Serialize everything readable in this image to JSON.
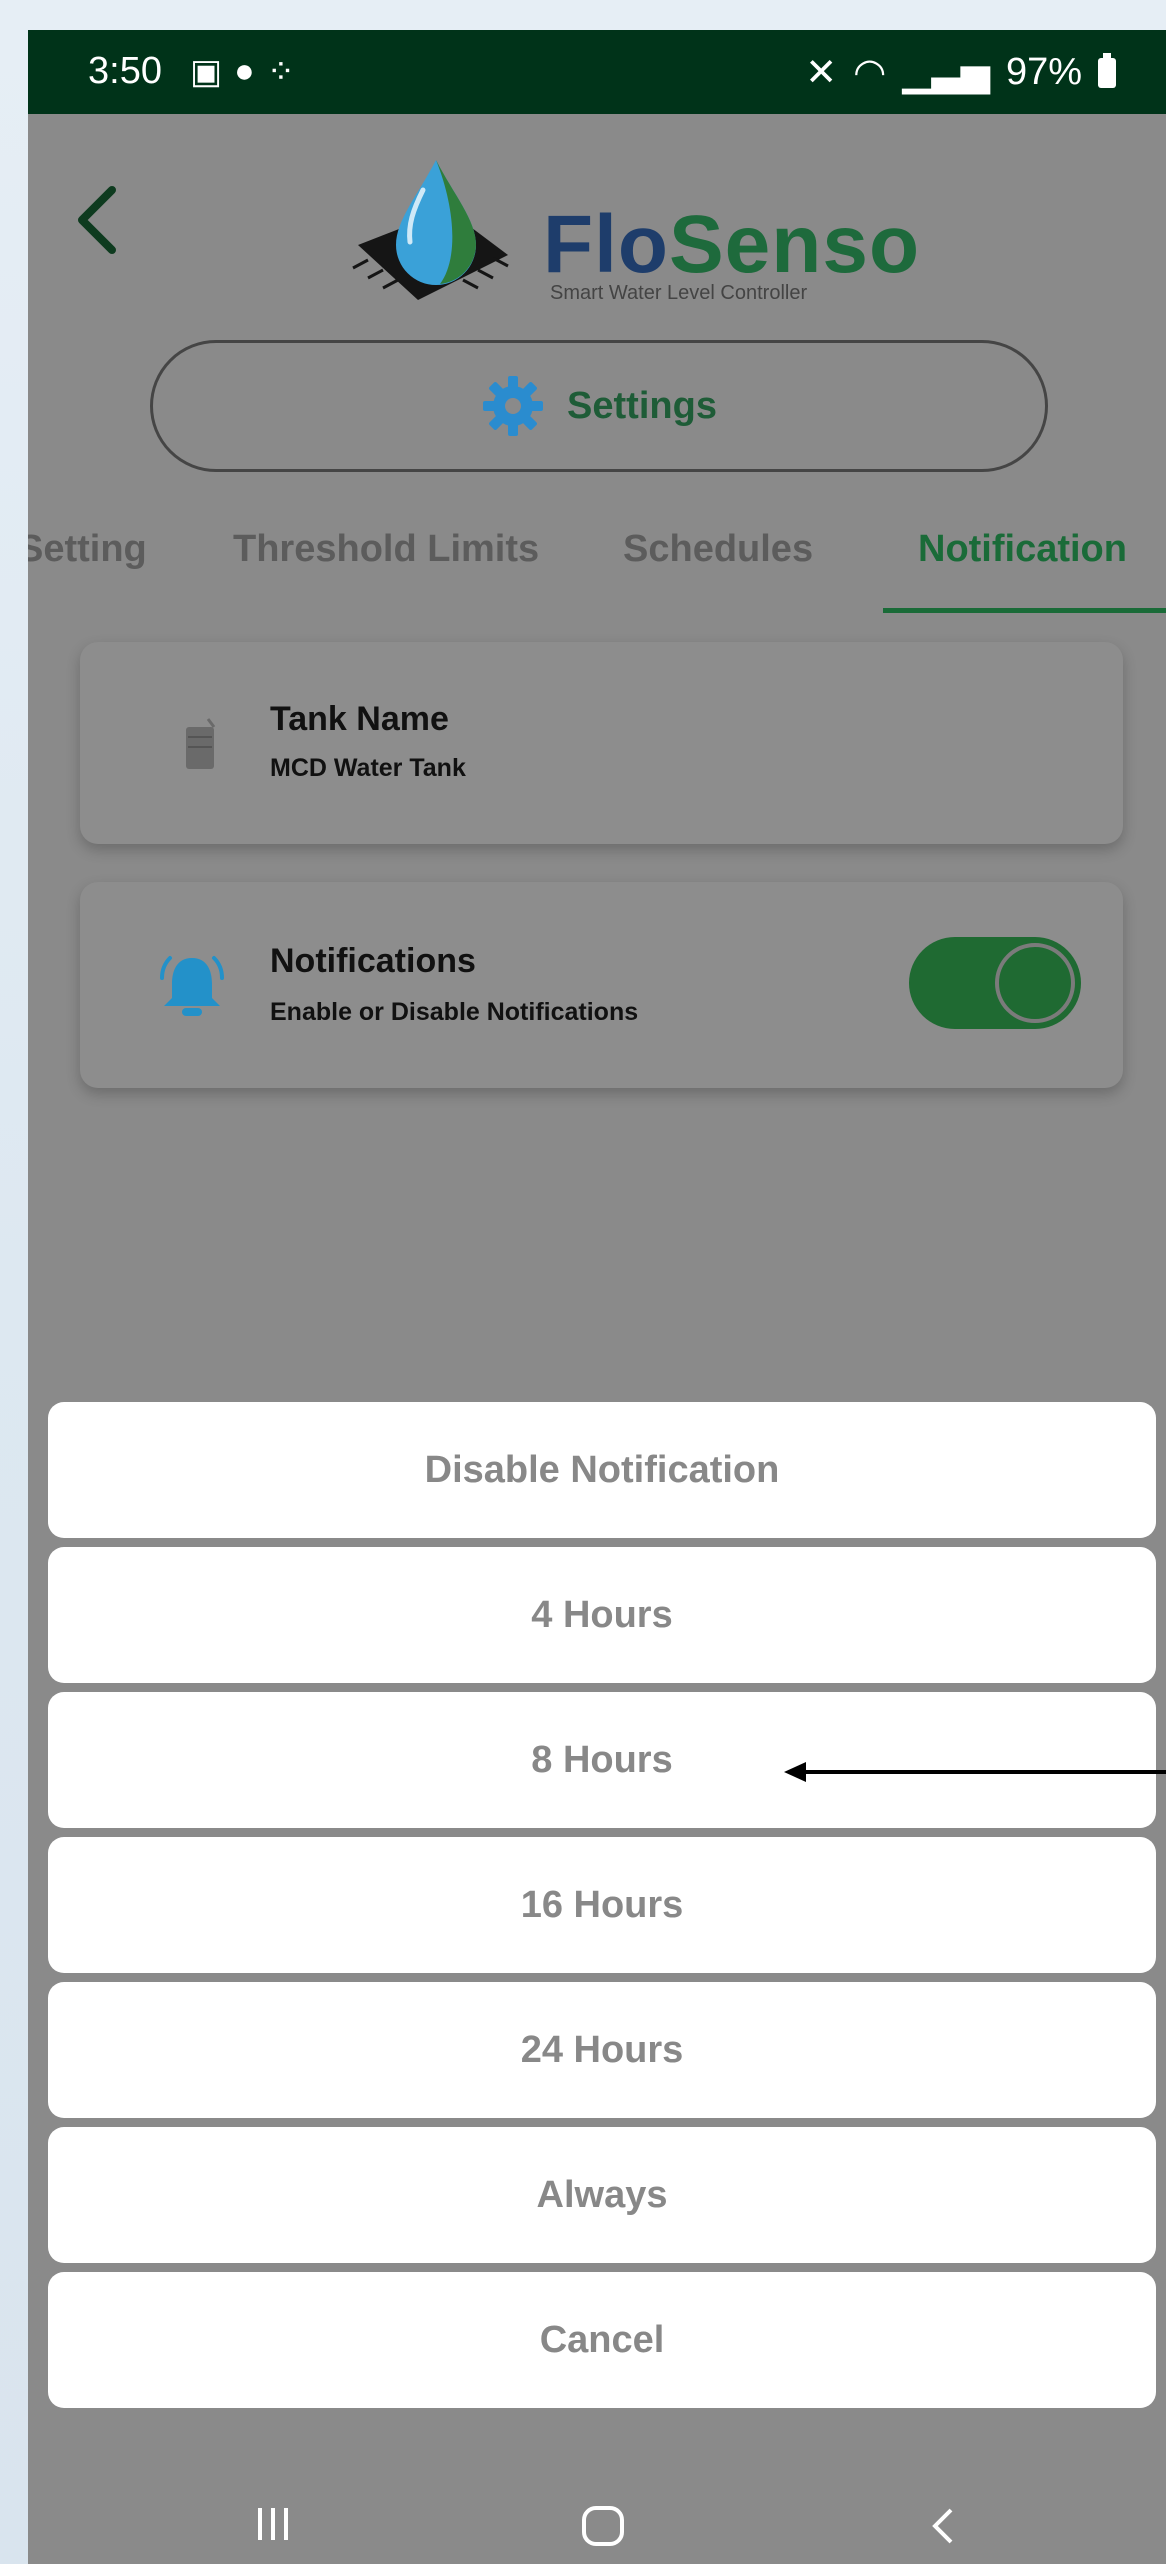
{
  "status_bar": {
    "time": "3:50",
    "battery": "97%"
  },
  "app": {
    "name_part1": "Flo",
    "name_part2": "Senso",
    "tagline": "Smart Water Level Controller"
  },
  "header": {
    "section_title": "Settings"
  },
  "tabs": [
    {
      "label": "Setting"
    },
    {
      "label": "Threshold Limits"
    },
    {
      "label": "Schedules"
    },
    {
      "label": "Notification"
    }
  ],
  "tank_card": {
    "title": "Tank Name",
    "value": "MCD Water Tank"
  },
  "notifications_card": {
    "title": "Notifications",
    "subtitle": "Enable or Disable Notifications",
    "enabled": true
  },
  "action_sheet": {
    "options": [
      "Disable Notification",
      "4 Hours",
      "8 Hours",
      "16 Hours",
      "24 Hours",
      "Always"
    ],
    "cancel_label": "Cancel"
  },
  "colors": {
    "brand_green": "#1a6b38",
    "status_bar": "#003319",
    "brand_blue": "#1e3d6b"
  }
}
